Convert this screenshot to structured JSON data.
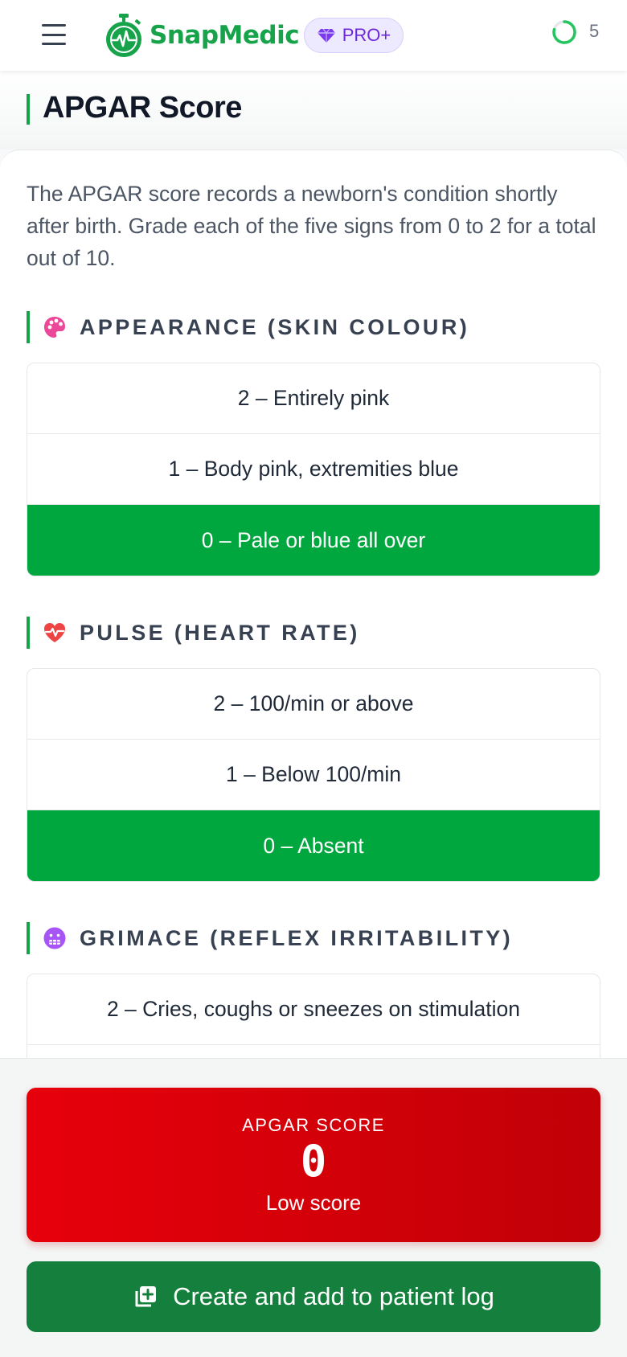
{
  "app": {
    "name": "SnapMedic",
    "badge": "PRO+",
    "counter": "5"
  },
  "page": {
    "title": "APGAR Score",
    "intro": "The APGAR score records a newborn's condition shortly after birth. Grade each of the five signs from 0 to 2 for a total out of 10."
  },
  "sections": [
    {
      "label": "Appearance (skin colour)",
      "icon": "palette-icon",
      "options": [
        "2 – Entirely pink",
        "1 – Body pink, extremities blue",
        "0 – Pale or blue all over"
      ],
      "selected_index": 2
    },
    {
      "label": "Pulse (heart rate)",
      "icon": "heart-pulse-icon",
      "options": [
        "2 – 100/min or above",
        "1 – Below 100/min",
        "0 – Absent"
      ],
      "selected_index": 2
    },
    {
      "label": "Grimace (reflex irritability)",
      "icon": "grimace-face-icon",
      "options": [
        "2 – Cries, coughs or sneezes on stimulation"
      ],
      "selected_index": -1
    }
  ],
  "result": {
    "label": "APGAR SCORE",
    "value": "0",
    "interpretation": "Low score"
  },
  "actions": {
    "create_label": "Create and add to patient log"
  },
  "colors": {
    "brand": "#16a34a",
    "selected": "#00a63e",
    "score_low": "#e7000b",
    "cta": "#15803d",
    "pro": "#6d28d9"
  }
}
